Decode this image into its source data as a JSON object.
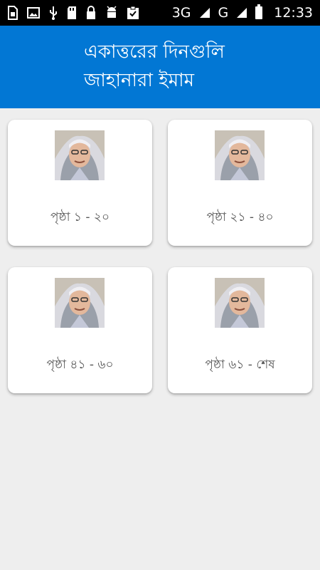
{
  "status_bar": {
    "network_label": "3G",
    "network2_label": "G",
    "time": "12:33",
    "icons": [
      "sim-icon",
      "image-icon",
      "usb-icon",
      "sd-card-icon",
      "lock-icon",
      "android-icon",
      "clipboard-check-icon"
    ]
  },
  "header": {
    "title": "একাত্তরের দিনগুলি",
    "author": "জাহানারা ইমাম",
    "color": "#0277d4"
  },
  "cards": [
    {
      "label": "পৃষ্ঠা ১ - ২০",
      "icon": "author-photo-icon"
    },
    {
      "label": "পৃষ্ঠা ২১ - ৪০",
      "icon": "author-photo-icon"
    },
    {
      "label": "পৃষ্ঠা ৪১ - ৬০",
      "icon": "author-photo-icon"
    },
    {
      "label": "পৃষ্ঠা ৬১ - শেষ",
      "icon": "author-photo-icon"
    }
  ]
}
